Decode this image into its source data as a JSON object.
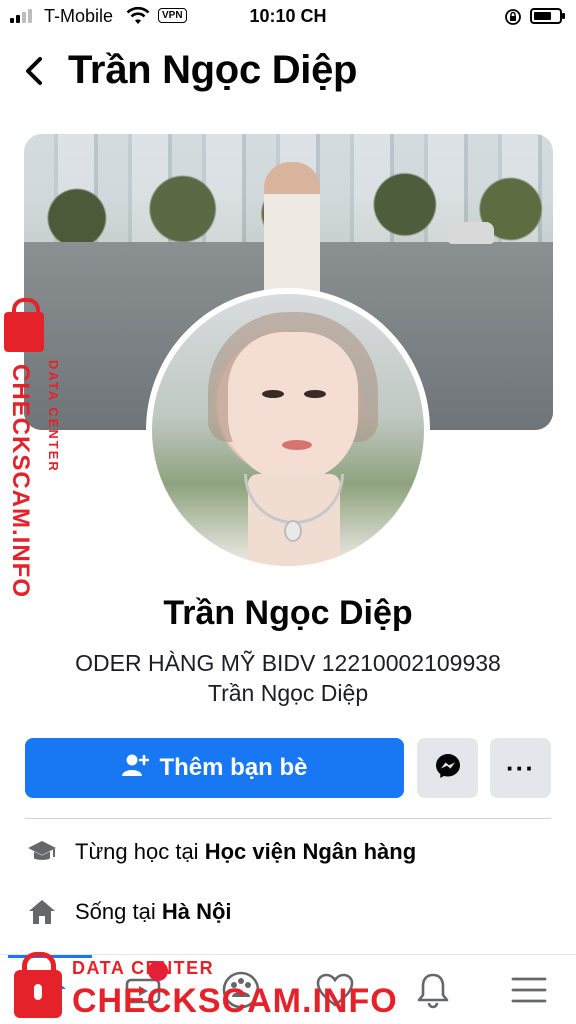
{
  "status_bar": {
    "carrier": "T-Mobile",
    "vpn": "VPN",
    "time": "10:10 CH",
    "battery_level": 0.7
  },
  "header": {
    "title": "Trần Ngọc Diệp"
  },
  "profile": {
    "name": "Trần Ngọc Diệp",
    "bio_line1": "ODER HÀNG MỸ BIDV 12210002109938",
    "bio_line2": "Trần Ngọc Diệp"
  },
  "actions": {
    "add_friend_label": "Thêm bạn bè",
    "more_label": "···"
  },
  "intro": {
    "school_prefix": "Từng học tại",
    "school_name": "Học viện Ngân hàng",
    "home_prefix": "Sống tại",
    "home_name": "Hà Nội"
  },
  "watermark": {
    "data_center": "DATA CENTER",
    "brand": "CHECKSCAM.INFO"
  },
  "colors": {
    "primary": "#1877f2",
    "watermark": "#e5222a",
    "button_grey": "#e4e6eb"
  }
}
